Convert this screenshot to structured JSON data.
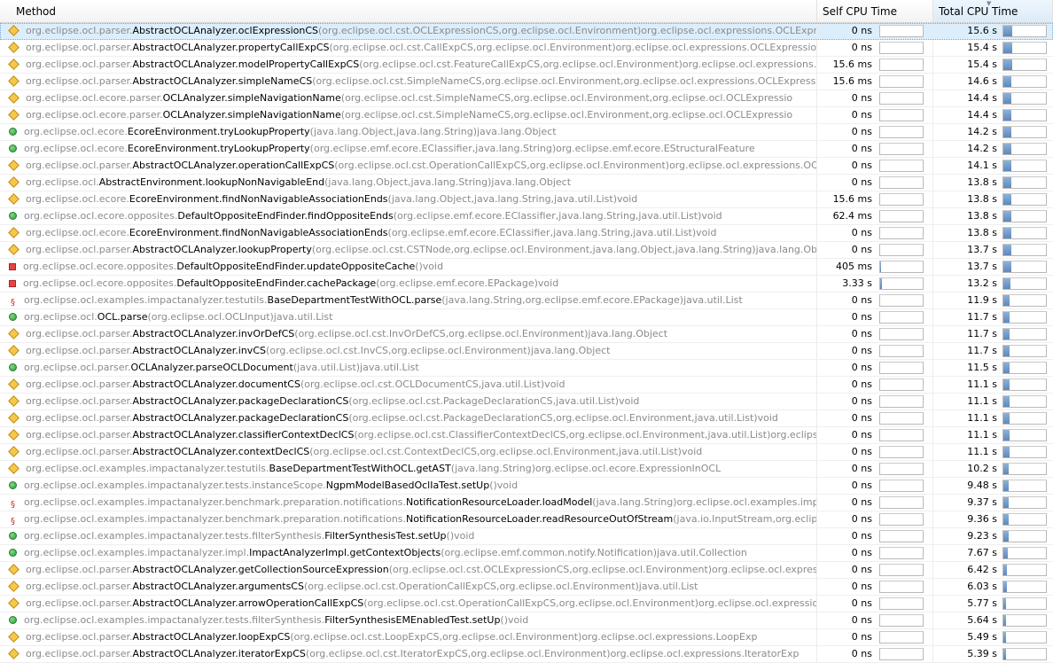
{
  "columns": {
    "method": "Method",
    "self": "Self CPU Time",
    "total": "Total CPU Time"
  },
  "rows": [
    {
      "icon": "diamond",
      "pkg": "org.eclipse.ocl.parser.",
      "cls": "AbstractOCLAnalyzer.oclExpressionCS",
      "sig": "(org.eclipse.ocl.cst.OCLExpressionCS,org.eclipse.ocl.Environment)org.eclipse.ocl.expressions.OCLExpression",
      "self": "0 ns",
      "total": "15.6 s",
      "self_frac": 0,
      "total_frac": 0.2,
      "selected": true
    },
    {
      "icon": "diamond",
      "pkg": "org.eclipse.ocl.parser.",
      "cls": "AbstractOCLAnalyzer.propertyCallExpCS",
      "sig": "(org.eclipse.ocl.cst.CallExpCS,org.eclipse.ocl.Environment)org.eclipse.ocl.expressions.OCLExpression",
      "self": "0 ns",
      "total": "15.4 s",
      "self_frac": 0,
      "total_frac": 0.2
    },
    {
      "icon": "diamond",
      "pkg": "org.eclipse.ocl.parser.",
      "cls": "AbstractOCLAnalyzer.modelPropertyCallExpCS",
      "sig": "(org.eclipse.ocl.cst.FeatureCallExpCS,org.eclipse.ocl.Environment)org.eclipse.ocl.expressions.OCLExpr",
      "self": "15.6 ms",
      "total": "15.4 s",
      "self_frac": 0,
      "total_frac": 0.2
    },
    {
      "icon": "diamond",
      "pkg": "org.eclipse.ocl.parser.",
      "cls": "AbstractOCLAnalyzer.simpleNameCS",
      "sig": "(org.eclipse.ocl.cst.SimpleNameCS,org.eclipse.ocl.Environment,org.eclipse.ocl.expressions.OCLExpression)org",
      "self": "15.6 ms",
      "total": "14.6 s",
      "self_frac": 0,
      "total_frac": 0.19
    },
    {
      "icon": "diamond",
      "pkg": "org.eclipse.ocl.ecore.parser.",
      "cls": "OCLAnalyzer.simpleNavigationName",
      "sig": "(org.eclipse.ocl.cst.SimpleNameCS,org.eclipse.ocl.Environment,org.eclipse.ocl.OCLExpressio",
      "self": "0 ns",
      "total": "14.4 s",
      "self_frac": 0,
      "total_frac": 0.18
    },
    {
      "icon": "diamond",
      "pkg": "org.eclipse.ocl.ecore.parser.",
      "cls": "OCLAnalyzer.simpleNavigationName",
      "sig": "(org.eclipse.ocl.cst.SimpleNameCS,org.eclipse.ocl.Environment,org.eclipse.ocl.OCLExpressio",
      "self": "0 ns",
      "total": "14.4 s",
      "self_frac": 0,
      "total_frac": 0.18
    },
    {
      "icon": "circle",
      "pkg": "org.eclipse.ocl.ecore.",
      "cls": "EcoreEnvironment.tryLookupProperty",
      "sig": "(java.lang.Object,java.lang.String)java.lang.Object",
      "self": "0 ns",
      "total": "14.2 s",
      "self_frac": 0,
      "total_frac": 0.18
    },
    {
      "icon": "circle",
      "pkg": "org.eclipse.ocl.ecore.",
      "cls": "EcoreEnvironment.tryLookupProperty",
      "sig": "(org.eclipse.emf.ecore.EClassifier,java.lang.String)org.eclipse.emf.ecore.EStructuralFeature",
      "self": "0 ns",
      "total": "14.2 s",
      "self_frac": 0,
      "total_frac": 0.18
    },
    {
      "icon": "diamond",
      "pkg": "org.eclipse.ocl.parser.",
      "cls": "AbstractOCLAnalyzer.operationCallExpCS",
      "sig": "(org.eclipse.ocl.cst.OperationCallExpCS,org.eclipse.ocl.Environment)org.eclipse.ocl.expressions.OCLExpres",
      "self": "0 ns",
      "total": "14.1 s",
      "self_frac": 0,
      "total_frac": 0.18
    },
    {
      "icon": "diamond",
      "pkg": "org.eclipse.ocl.",
      "cls": "AbstractEnvironment.lookupNonNavigableEnd",
      "sig": "(java.lang.Object,java.lang.String)java.lang.Object",
      "self": "0 ns",
      "total": "13.8 s",
      "self_frac": 0,
      "total_frac": 0.18
    },
    {
      "icon": "diamond",
      "pkg": "org.eclipse.ocl.ecore.",
      "cls": "EcoreEnvironment.findNonNavigableAssociationEnds",
      "sig": "(java.lang.Object,java.lang.String,java.util.List)void",
      "self": "15.6 ms",
      "total": "13.8 s",
      "self_frac": 0,
      "total_frac": 0.18
    },
    {
      "icon": "circle",
      "pkg": "org.eclipse.ocl.ecore.opposites.",
      "cls": "DefaultOppositeEndFinder.findOppositeEnds",
      "sig": "(org.eclipse.emf.ecore.EClassifier,java.lang.String,java.util.List)void",
      "self": "62.4 ms",
      "total": "13.8 s",
      "self_frac": 0,
      "total_frac": 0.18
    },
    {
      "icon": "diamond",
      "pkg": "org.eclipse.ocl.ecore.",
      "cls": "EcoreEnvironment.findNonNavigableAssociationEnds",
      "sig": "(org.eclipse.emf.ecore.EClassifier,java.lang.String,java.util.List)void",
      "self": "0 ns",
      "total": "13.8 s",
      "self_frac": 0,
      "total_frac": 0.18
    },
    {
      "icon": "diamond",
      "pkg": "org.eclipse.ocl.parser.",
      "cls": "AbstractOCLAnalyzer.lookupProperty",
      "sig": "(org.eclipse.ocl.cst.CSTNode,org.eclipse.ocl.Environment,java.lang.Object,java.lang.String)java.lang.Object",
      "self": "0 ns",
      "total": "13.7 s",
      "self_frac": 0,
      "total_frac": 0.18
    },
    {
      "icon": "square",
      "pkg": "org.eclipse.ocl.ecore.opposites.",
      "cls": "DefaultOppositeEndFinder.updateOppositeCache",
      "sig": "()void",
      "self": "405 ms",
      "total": "13.7 s",
      "self_frac": 0.02,
      "total_frac": 0.18
    },
    {
      "icon": "square",
      "pkg": "org.eclipse.ocl.ecore.opposites.",
      "cls": "DefaultOppositeEndFinder.cachePackage",
      "sig": "(org.eclipse.emf.ecore.EPackage)void",
      "self": "3.33 s",
      "total": "13.2 s",
      "self_frac": 0.04,
      "total_frac": 0.17
    },
    {
      "icon": "lock",
      "pkg": "org.eclipse.ocl.examples.impactanalyzer.testutils.",
      "cls": "BaseDepartmentTestWithOCL.parse",
      "sig": "(java.lang.String,org.eclipse.emf.ecore.EPackage)java.util.List",
      "self": "0 ns",
      "total": "11.9 s",
      "self_frac": 0,
      "total_frac": 0.15
    },
    {
      "icon": "circle",
      "pkg": "org.eclipse.ocl.",
      "cls": "OCL.parse",
      "sig": "(org.eclipse.ocl.OCLInput)java.util.List",
      "self": "0 ns",
      "total": "11.7 s",
      "self_frac": 0,
      "total_frac": 0.15
    },
    {
      "icon": "diamond",
      "pkg": "org.eclipse.ocl.parser.",
      "cls": "AbstractOCLAnalyzer.invOrDefCS",
      "sig": "(org.eclipse.ocl.cst.InvOrDefCS,org.eclipse.ocl.Environment)java.lang.Object",
      "self": "0 ns",
      "total": "11.7 s",
      "self_frac": 0,
      "total_frac": 0.15
    },
    {
      "icon": "diamond",
      "pkg": "org.eclipse.ocl.parser.",
      "cls": "AbstractOCLAnalyzer.invCS",
      "sig": "(org.eclipse.ocl.cst.InvCS,org.eclipse.ocl.Environment)java.lang.Object",
      "self": "0 ns",
      "total": "11.7 s",
      "self_frac": 0,
      "total_frac": 0.15
    },
    {
      "icon": "circle",
      "pkg": "org.eclipse.ocl.parser.",
      "cls": "OCLAnalyzer.parseOCLDocument",
      "sig": "(java.util.List)java.util.List",
      "self": "0 ns",
      "total": "11.5 s",
      "self_frac": 0,
      "total_frac": 0.15
    },
    {
      "icon": "diamond",
      "pkg": "org.eclipse.ocl.parser.",
      "cls": "AbstractOCLAnalyzer.documentCS",
      "sig": "(org.eclipse.ocl.cst.OCLDocumentCS,java.util.List)void",
      "self": "0 ns",
      "total": "11.1 s",
      "self_frac": 0,
      "total_frac": 0.14
    },
    {
      "icon": "diamond",
      "pkg": "org.eclipse.ocl.parser.",
      "cls": "AbstractOCLAnalyzer.packageDeclarationCS",
      "sig": "(org.eclipse.ocl.cst.PackageDeclarationCS,java.util.List)void",
      "self": "0 ns",
      "total": "11.1 s",
      "self_frac": 0,
      "total_frac": 0.14
    },
    {
      "icon": "diamond",
      "pkg": "org.eclipse.ocl.parser.",
      "cls": "AbstractOCLAnalyzer.packageDeclarationCS",
      "sig": "(org.eclipse.ocl.cst.PackageDeclarationCS,org.eclipse.ocl.Environment,java.util.List)void",
      "self": "0 ns",
      "total": "11.1 s",
      "self_frac": 0,
      "total_frac": 0.14
    },
    {
      "icon": "diamond",
      "pkg": "org.eclipse.ocl.parser.",
      "cls": "AbstractOCLAnalyzer.classifierContextDeclCS",
      "sig": "(org.eclipse.ocl.cst.ClassifierContextDeclCS,org.eclipse.ocl.Environment,java.util.List)org.eclipse.ocl.Env",
      "self": "0 ns",
      "total": "11.1 s",
      "self_frac": 0,
      "total_frac": 0.14
    },
    {
      "icon": "diamond",
      "pkg": "org.eclipse.ocl.parser.",
      "cls": "AbstractOCLAnalyzer.contextDeclCS",
      "sig": "(org.eclipse.ocl.cst.ContextDeclCS,org.eclipse.ocl.Environment,java.util.List)void",
      "self": "0 ns",
      "total": "11.1 s",
      "self_frac": 0,
      "total_frac": 0.14
    },
    {
      "icon": "diamond",
      "pkg": "org.eclipse.ocl.examples.impactanalyzer.testutils.",
      "cls": "BaseDepartmentTestWithOCL.getAST",
      "sig": "(java.lang.String)org.eclipse.ocl.ecore.ExpressionInOCL",
      "self": "0 ns",
      "total": "10.2 s",
      "self_frac": 0,
      "total_frac": 0.13
    },
    {
      "icon": "circle",
      "pkg": "org.eclipse.ocl.examples.impactanalyzer.tests.instanceScope.",
      "cls": "NgpmModelBasedOclIaTest.setUp",
      "sig": "()void",
      "self": "0 ns",
      "total": "9.48 s",
      "self_frac": 0,
      "total_frac": 0.12
    },
    {
      "icon": "lock",
      "pkg": "org.eclipse.ocl.examples.impactanalyzer.benchmark.preparation.notifications.",
      "cls": "NotificationResourceLoader.loadModel",
      "sig": "(java.lang.String)org.eclipse.ocl.examples.impactana",
      "self": "0 ns",
      "total": "9.37 s",
      "self_frac": 0,
      "total_frac": 0.12
    },
    {
      "icon": "lock",
      "pkg": "org.eclipse.ocl.examples.impactanalyzer.benchmark.preparation.notifications.",
      "cls": "NotificationResourceLoader.readResourceOutOfStream",
      "sig": "(java.io.InputStream,org.eclipse.emf",
      "self": "0 ns",
      "total": "9.36 s",
      "self_frac": 0,
      "total_frac": 0.12
    },
    {
      "icon": "circle",
      "pkg": "org.eclipse.ocl.examples.impactanalyzer.tests.filterSynthesis.",
      "cls": "FilterSynthesisTest.setUp",
      "sig": "()void",
      "self": "0 ns",
      "total": "9.23 s",
      "self_frac": 0,
      "total_frac": 0.12
    },
    {
      "icon": "circle",
      "pkg": "org.eclipse.ocl.examples.impactanalyzer.impl.",
      "cls": "ImpactAnalyzerImpl.getContextObjects",
      "sig": "(org.eclipse.emf.common.notify.Notification)java.util.Collection",
      "self": "0 ns",
      "total": "7.67 s",
      "self_frac": 0,
      "total_frac": 0.1
    },
    {
      "icon": "diamond",
      "pkg": "org.eclipse.ocl.parser.",
      "cls": "AbstractOCLAnalyzer.getCollectionSourceExpression",
      "sig": "(org.eclipse.ocl.cst.OCLExpressionCS,org.eclipse.ocl.Environment)org.eclipse.ocl.expressions.O",
      "self": "0 ns",
      "total": "6.42 s",
      "self_frac": 0,
      "total_frac": 0.08
    },
    {
      "icon": "diamond",
      "pkg": "org.eclipse.ocl.parser.",
      "cls": "AbstractOCLAnalyzer.argumentsCS",
      "sig": "(org.eclipse.ocl.cst.OperationCallExpCS,org.eclipse.ocl.Environment)java.util.List",
      "self": "0 ns",
      "total": "6.03 s",
      "self_frac": 0,
      "total_frac": 0.08
    },
    {
      "icon": "diamond",
      "pkg": "org.eclipse.ocl.parser.",
      "cls": "AbstractOCLAnalyzer.arrowOperationCallExpCS",
      "sig": "(org.eclipse.ocl.cst.OperationCallExpCS,org.eclipse.ocl.Environment)org.eclipse.ocl.expressions.OCLI",
      "self": "0 ns",
      "total": "5.77 s",
      "self_frac": 0,
      "total_frac": 0.07
    },
    {
      "icon": "circle",
      "pkg": "org.eclipse.ocl.examples.impactanalyzer.tests.filterSynthesis.",
      "cls": "FilterSynthesisEMEnabledTest.setUp",
      "sig": "()void",
      "self": "0 ns",
      "total": "5.64 s",
      "self_frac": 0,
      "total_frac": 0.07
    },
    {
      "icon": "diamond",
      "pkg": "org.eclipse.ocl.parser.",
      "cls": "AbstractOCLAnalyzer.loopExpCS",
      "sig": "(org.eclipse.ocl.cst.LoopExpCS,org.eclipse.ocl.Environment)org.eclipse.ocl.expressions.LoopExp",
      "self": "0 ns",
      "total": "5.49 s",
      "self_frac": 0,
      "total_frac": 0.07
    },
    {
      "icon": "diamond",
      "pkg": "org.eclipse.ocl.parser.",
      "cls": "AbstractOCLAnalyzer.iteratorExpCS",
      "sig": "(org.eclipse.ocl.cst.IteratorExpCS,org.eclipse.ocl.Environment)org.eclipse.ocl.expressions.IteratorExp",
      "self": "0 ns",
      "total": "5.39 s",
      "self_frac": 0,
      "total_frac": 0.07
    }
  ]
}
